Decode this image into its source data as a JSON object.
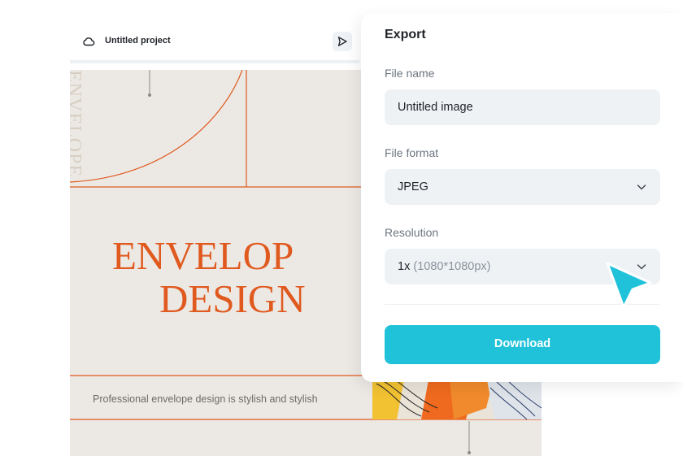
{
  "topbar": {
    "project_title": "Untitled project"
  },
  "canvas": {
    "vertical_text": "ENVELOPE",
    "heading_line1": "ENVELOP",
    "heading_line2": "DESIGN",
    "subtitle": "Professional envelope design is stylish and stylish",
    "accent_color": "#e05a1f"
  },
  "export": {
    "title": "Export",
    "file_name_label": "File name",
    "file_name_value": "Untitled image",
    "file_format_label": "File format",
    "file_format_value": "JPEG",
    "resolution_label": "Resolution",
    "resolution_value": "1x",
    "resolution_detail": "(1080*1080px)",
    "download_label": "Download",
    "accent_color": "#1fc2d9"
  },
  "icons": {
    "cloud": "cloud-icon",
    "share": "send-icon",
    "chevron": "chevron-down-icon",
    "cursor": "pointer-cursor-icon"
  }
}
